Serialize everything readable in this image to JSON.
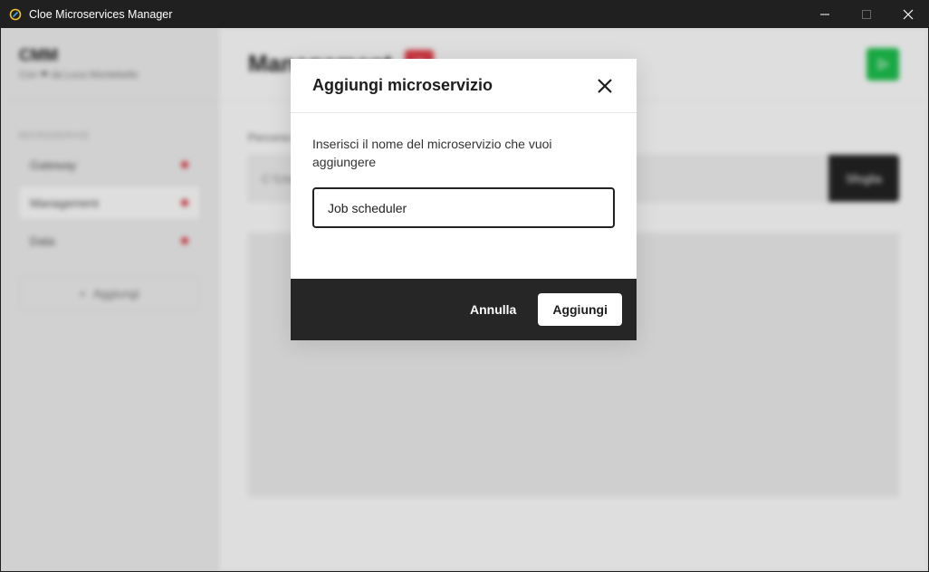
{
  "window": {
    "title": "Cloe Microservices Manager"
  },
  "sidebar": {
    "brand": "CMM",
    "subtitle": "Con ❤ da Luca Montebello",
    "section_label": "MICROSERVIZI",
    "items": [
      {
        "label": "Gateway"
      },
      {
        "label": "Management"
      },
      {
        "label": "Data"
      }
    ],
    "add_label": "Aggiungi"
  },
  "main": {
    "title": "Management",
    "path_label": "Percorso",
    "path_placeholder": "C:\\Users",
    "path_button": "Sfoglia"
  },
  "modal": {
    "title": "Aggiungi microservizio",
    "description": "Inserisci il nome del microservizio che vuoi aggiungere",
    "input_value": "Job scheduler",
    "cancel_label": "Annulla",
    "confirm_label": "Aggiungi"
  },
  "colors": {
    "status_dot": "#e0414a",
    "delete_button": "#e8404a",
    "run_button": "#1cc24e",
    "dark": "#262626"
  }
}
